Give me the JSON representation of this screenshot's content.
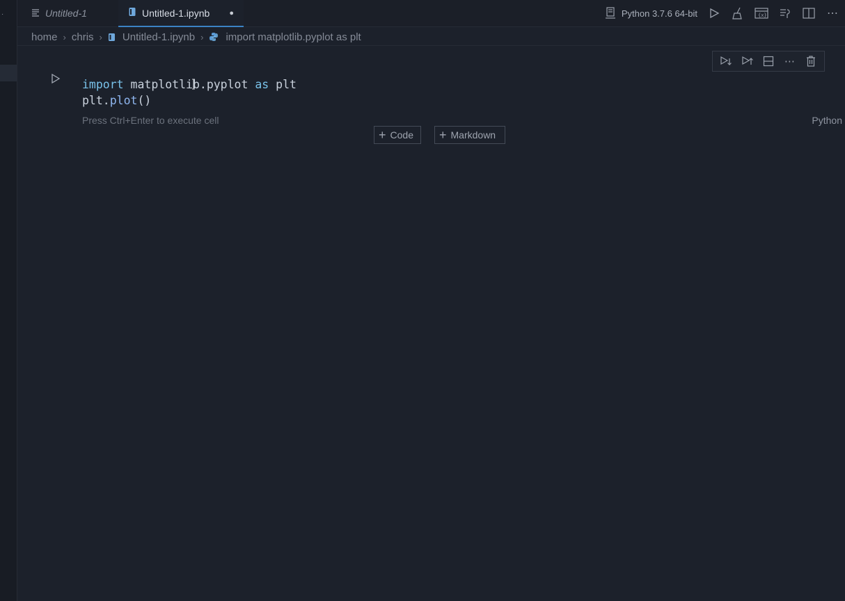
{
  "tabs": [
    {
      "label": "Untitled-1",
      "icon": "text-file-icon",
      "active": false
    },
    {
      "label": "Untitled-1.ipynb",
      "icon": "notebook-icon",
      "active": true,
      "modified_indicator": "●"
    }
  ],
  "kernel": {
    "label": "Python 3.7.6 64-bit",
    "icons": [
      "kernel-server-icon",
      "run-all-icon",
      "clear-outputs-icon",
      "variables-icon",
      "toggle-output-icon",
      "split-editor-icon",
      "more-actions-icon"
    ]
  },
  "breadcrumb": {
    "items": [
      "home",
      "chris",
      "Untitled-1.ipynb",
      "import matplotlib.pyplot as plt"
    ],
    "separator": ">"
  },
  "cell_toolbar": {
    "icons": [
      "run-below-icon",
      "run-above-icon",
      "split-cell-icon",
      "more-icon",
      "delete-cell-icon"
    ]
  },
  "cell": {
    "lines": [
      {
        "kw": "import",
        "rest": " matplotlib.pyplot ",
        "kw2": "as",
        "rest2": " plt"
      },
      {
        "obj": "plt.",
        "fn": "plot",
        "tail": "()"
      }
    ],
    "hint": "Press Ctrl+Enter to execute cell",
    "language": "Python"
  },
  "add_buttons": {
    "code_label": "Code",
    "markdown_label": "Markdown"
  },
  "colors": {
    "background": "#1c212b",
    "keyword": "#79c2ea",
    "active_tab_border": "#3b82c4"
  }
}
